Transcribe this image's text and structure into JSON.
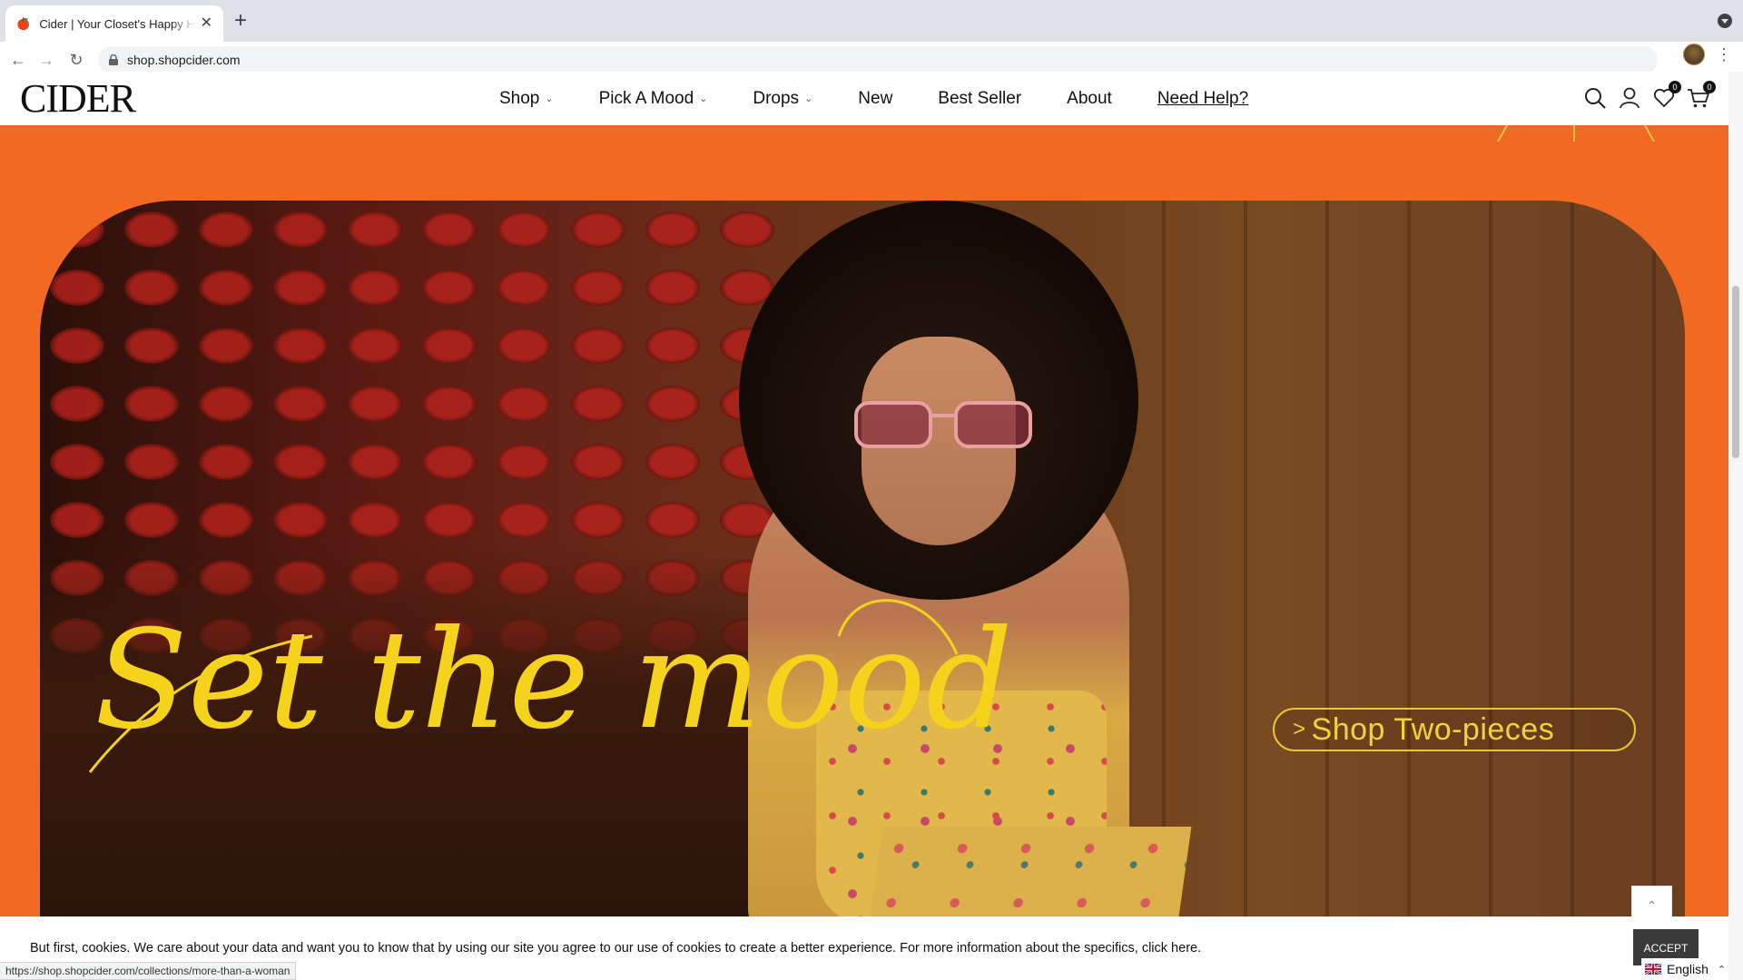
{
  "browser": {
    "tab_title": "Cider | Your Closet's Happy Ho",
    "tab_close": "✕",
    "new_tab": "+",
    "url": "shop.shopcider.com",
    "status_url": "https://shop.shopcider.com/collections/more-than-a-woman"
  },
  "header": {
    "logo": "CIDER",
    "nav": [
      {
        "label": "Shop",
        "dropdown": true
      },
      {
        "label": "Pick A Mood",
        "dropdown": true
      },
      {
        "label": "Drops",
        "dropdown": true
      },
      {
        "label": "New",
        "dropdown": false
      },
      {
        "label": "Best Seller",
        "dropdown": false
      },
      {
        "label": "About",
        "dropdown": false
      },
      {
        "label": "Need Help?",
        "dropdown": false
      }
    ],
    "wishlist_count": "0",
    "cart_count": "0"
  },
  "hero": {
    "headline": "Set the mood",
    "cta_arrow": ">",
    "cta_label": "Shop Two-pieces",
    "bg_color": "#f26a22",
    "accent_color": "#f2d23a"
  },
  "cookie": {
    "message": "But first, cookies. We care about your data and want you to know that by using our site you agree to our use of cookies to create a better experience. For more information about the specifics, click here.",
    "accept": "ACCEPT"
  },
  "language": {
    "current": "English"
  }
}
